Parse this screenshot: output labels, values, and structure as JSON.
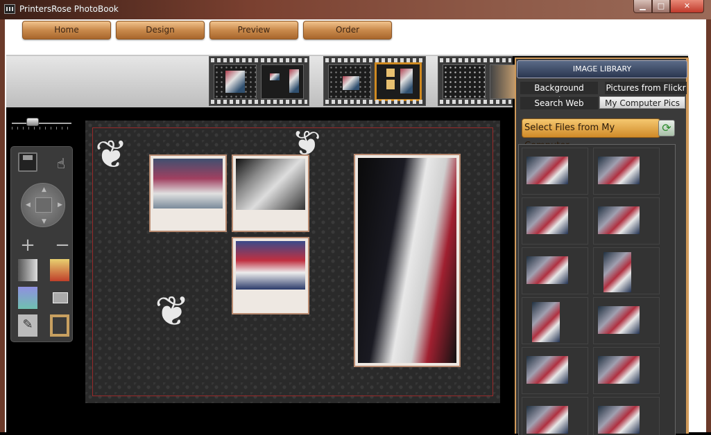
{
  "window": {
    "title": "PrintersRose PhotoBook",
    "min": "▁",
    "max": "□",
    "close": "✕"
  },
  "nav": [
    "Home",
    "Design",
    "Preview",
    "Order"
  ],
  "library": {
    "header": "IMAGE LIBRARY",
    "tabs": [
      "Background Designs",
      "Pictures from Flickr",
      "Search Web",
      "My Computer Pics"
    ],
    "active_tab": "My Computer Pics",
    "select_button": "Select Files from My Computer",
    "refresh_icon": "⟳"
  },
  "tools": {
    "hand_icon": "☝",
    "plus": "+",
    "minus": "−",
    "sketch_icon": "✎"
  },
  "decor": {
    "swirl": "❦"
  },
  "colors": {
    "accent": "#d08a28",
    "frame": "#b88a70",
    "guide": "#9a2a2a"
  }
}
